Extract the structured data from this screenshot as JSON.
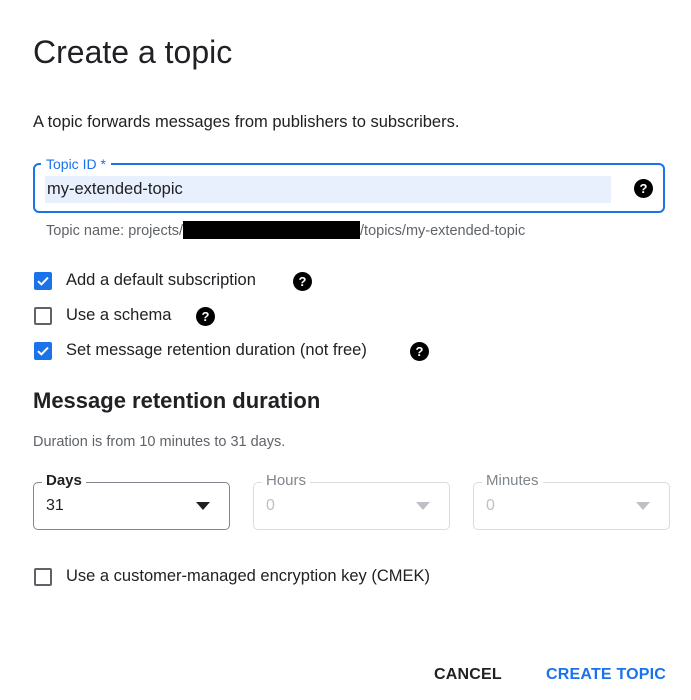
{
  "dialog": {
    "title": "Create a topic",
    "description": "A topic forwards messages from publishers to subscribers."
  },
  "topic_id": {
    "label": "Topic ID *",
    "value": "my-extended-topic",
    "help_icon": "help-circle-icon",
    "helper_prefix": "Topic name: projects/",
    "helper_suffix": "/topics/my-extended-topic"
  },
  "options": [
    {
      "label": "Add a default subscription",
      "checked": true,
      "has_help": true
    },
    {
      "label": "Use a schema",
      "checked": false,
      "has_help": true
    },
    {
      "label": "Set message retention duration (not free)",
      "checked": true,
      "has_help": true
    }
  ],
  "retention": {
    "title": "Message retention duration",
    "description": "Duration is from 10 minutes to 31 days.",
    "fields": [
      {
        "label": "Days",
        "value": "31",
        "enabled": true
      },
      {
        "label": "Hours",
        "value": "0",
        "enabled": false
      },
      {
        "label": "Minutes",
        "value": "0",
        "enabled": false
      }
    ]
  },
  "cmek": {
    "label": "Use a customer-managed encryption key (CMEK)",
    "checked": false
  },
  "actions": {
    "cancel": "CANCEL",
    "create": "CREATE TOPIC"
  },
  "colors": {
    "accent": "#1a73e8",
    "input_highlight": "#e8f0fe",
    "text": "#202124",
    "secondary": "#5f6368"
  }
}
